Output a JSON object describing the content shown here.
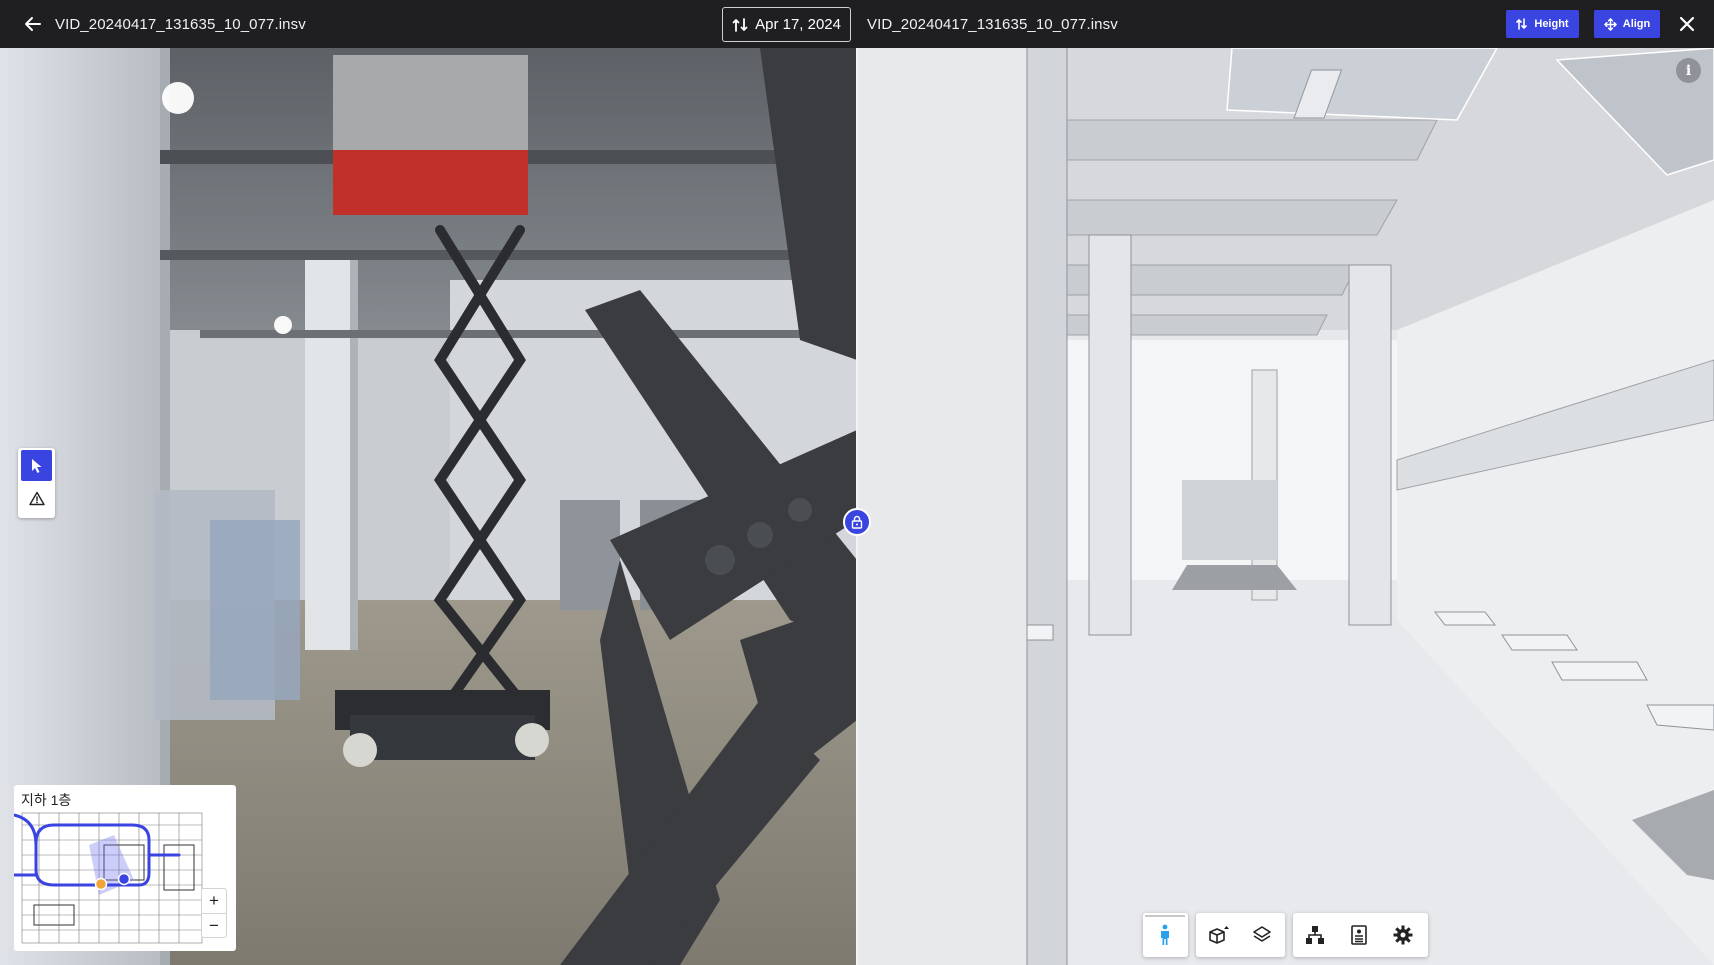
{
  "left_panel": {
    "file_name": "VID_20240417_131635_10_077.insv",
    "date_label": "Apr 17, 2024",
    "minimap": {
      "title": "지하 1층",
      "zoom_in": "+",
      "zoom_out": "−"
    },
    "tools": [
      {
        "name": "select-tool",
        "active": true
      },
      {
        "name": "issue-tool",
        "active": false
      }
    ]
  },
  "right_panel": {
    "file_name": "VID_20240417_131635_10_077.insv",
    "height_label": "Height",
    "align_label": "Align",
    "info_label": "i",
    "bottom_toolbar": [
      {
        "icon": "person-icon",
        "active": true
      },
      {
        "icon": "section-box-icon",
        "active": false
      },
      {
        "icon": "layers-icon",
        "active": false
      },
      {
        "icon": "hierarchy-icon",
        "active": false
      },
      {
        "icon": "properties-icon",
        "active": false
      },
      {
        "icon": "settings-icon",
        "active": false
      }
    ]
  },
  "colors": {
    "accent": "#3a44e0",
    "topbar": "#1f1f21"
  }
}
